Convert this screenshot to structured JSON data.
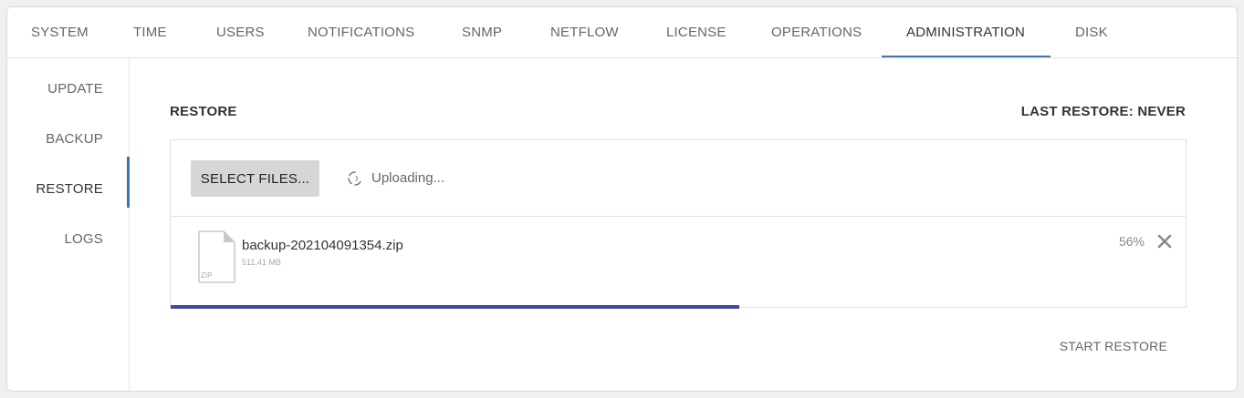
{
  "tabs": [
    {
      "label": "SYSTEM"
    },
    {
      "label": "TIME"
    },
    {
      "label": "USERS"
    },
    {
      "label": "NOTIFICATIONS"
    },
    {
      "label": "SNMP"
    },
    {
      "label": "NETFLOW"
    },
    {
      "label": "LICENSE"
    },
    {
      "label": "OPERATIONS"
    },
    {
      "label": "ADMINISTRATION",
      "active": true
    },
    {
      "label": "DISK"
    }
  ],
  "sidebar": {
    "items": [
      {
        "label": "UPDATE"
      },
      {
        "label": "BACKUP"
      },
      {
        "label": "RESTORE",
        "active": true
      },
      {
        "label": "LOGS"
      }
    ]
  },
  "restore": {
    "title": "RESTORE",
    "last_restore": "LAST RESTORE: NEVER",
    "select_files_label": "SELECT FILES...",
    "status": "Uploading...",
    "file": {
      "name": "backup-202104091354.zip",
      "size": "511.41 MB",
      "type_label": "ZIP",
      "percent_text": "56%",
      "progress": 0.56
    },
    "start_restore_label": "START RESTORE"
  },
  "colors": {
    "accent": "#3b73b9",
    "progress": "#3f4a9e",
    "button_bg": "#d6d6d6"
  },
  "icons": {
    "spinner": "loading-spinner-icon",
    "file": "zip-file-icon",
    "remove": "close-icon"
  }
}
